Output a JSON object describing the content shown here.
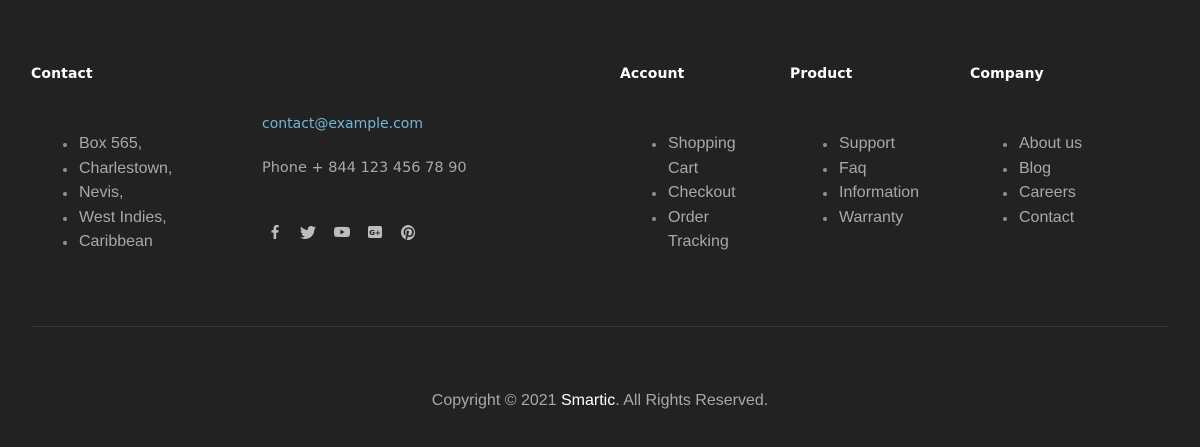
{
  "contact": {
    "heading": "Contact",
    "address_lines": [
      "Box 565,",
      "Charlestown,",
      "Nevis,",
      "West Indies,",
      "Caribbean"
    ],
    "email": "contact@example.com",
    "phone": "Phone + 844 123 456 78 90",
    "social_icons": [
      "facebook-icon",
      "twitter-icon",
      "youtube-icon",
      "google-plus-icon",
      "pinterest-icon"
    ]
  },
  "account": {
    "heading": "Account",
    "links": [
      "Shopping Cart",
      "Checkout",
      "Order Tracking"
    ]
  },
  "product": {
    "heading": "Product",
    "links": [
      "Support",
      "Faq",
      "Information",
      "Warranty"
    ]
  },
  "company": {
    "heading": "Company",
    "links": [
      "About us",
      "Blog",
      "Careers",
      "Contact"
    ]
  },
  "copyright": {
    "prefix": "Copyright © 2021 ",
    "brand": "Smartic",
    "suffix": ". All Rights Reserved."
  },
  "colors": {
    "background": "#222222",
    "heading": "#ffffff",
    "text": "#a8a8a8",
    "email": "#6fb8d6",
    "divider": "#3a3a3a"
  }
}
